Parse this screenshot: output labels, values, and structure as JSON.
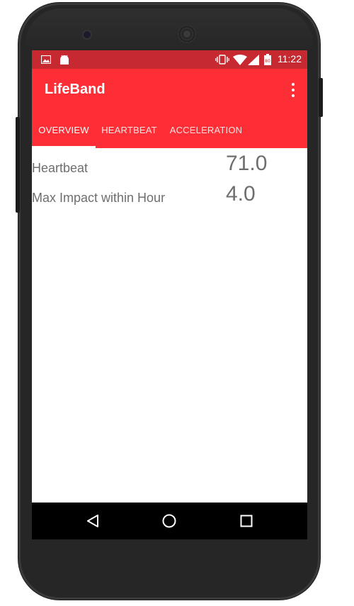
{
  "status_bar": {
    "time": "11:22",
    "left_icons": [
      "image-icon",
      "android-icon"
    ],
    "right_icons": [
      "vibrate-icon",
      "wifi-icon",
      "signal-icon",
      "battery-icon"
    ],
    "color": "#c62a30"
  },
  "app_bar": {
    "title": "LifeBand",
    "color": "#fd2e36"
  },
  "tabs": [
    {
      "label": "OVERVIEW",
      "selected": true
    },
    {
      "label": "HEARTBEAT",
      "selected": false
    },
    {
      "label": "ACCELERATION",
      "selected": false
    }
  ],
  "overview": {
    "rows": [
      {
        "label": "Heartbeat",
        "value": "71.0"
      },
      {
        "label": "Max Impact within Hour",
        "value": "4.0"
      }
    ]
  },
  "nav_bar": {
    "buttons": [
      "back-icon",
      "home-icon",
      "recents-icon"
    ]
  }
}
